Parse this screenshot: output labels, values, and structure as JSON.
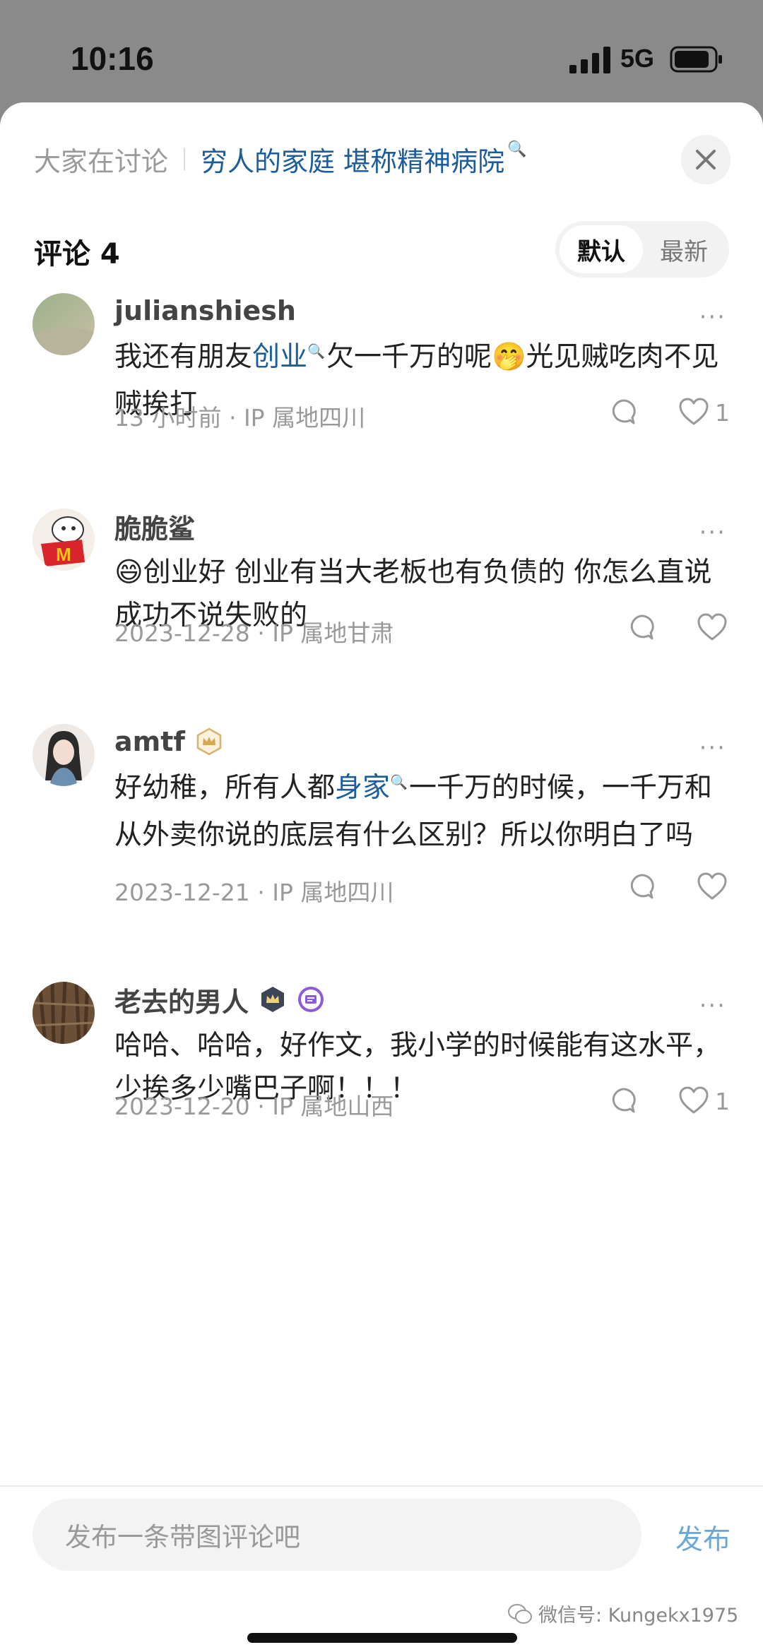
{
  "status": {
    "time": "10:16",
    "network": "5G"
  },
  "topic": {
    "label": "大家在讨论",
    "title": "穷人的家庭 堪称精神病院"
  },
  "header": {
    "title": "评论 4",
    "tabs": [
      "默认",
      "最新"
    ]
  },
  "comments": [
    {
      "user": "julianshiesh",
      "text_parts": [
        "我还有朋友",
        "创业",
        "欠一千万的呢",
        "🤭",
        "光见贼吃肉不见贼挨打"
      ],
      "meta": "13 小时前 · IP 属地四川",
      "likes": "1"
    },
    {
      "user": "脆脆鲨",
      "text": "😄创业好 创业有当大老板也有负债的 你怎么直说成功不说失败的",
      "meta": "2023-12-28 · IP 属地甘肃",
      "likes": ""
    },
    {
      "user": "amtf",
      "text_parts": [
        "好幼稚，所有人都",
        "身家",
        "一千万的时候，一千万和从外卖你说的底层有什么区别？所以你明白了吗"
      ],
      "meta": "2023-12-21 · IP 属地四川",
      "likes": ""
    },
    {
      "user": "老去的男人",
      "text": "哈哈、哈哈，好作文，我小学的时候能有这水平，少挨多少嘴巴子啊！！！",
      "meta": "2023-12-20 · IP 属地山西",
      "likes": "1"
    }
  ],
  "more_glyph": "···",
  "search_glyph": "🔍",
  "input": {
    "placeholder": "发布一条带图评论吧"
  },
  "send_label": "发布",
  "watermark": "微信号: Kungekx1975",
  "colors": {
    "link": "#1d5d9b",
    "send": "#6aa8d8",
    "muted": "#999999"
  }
}
